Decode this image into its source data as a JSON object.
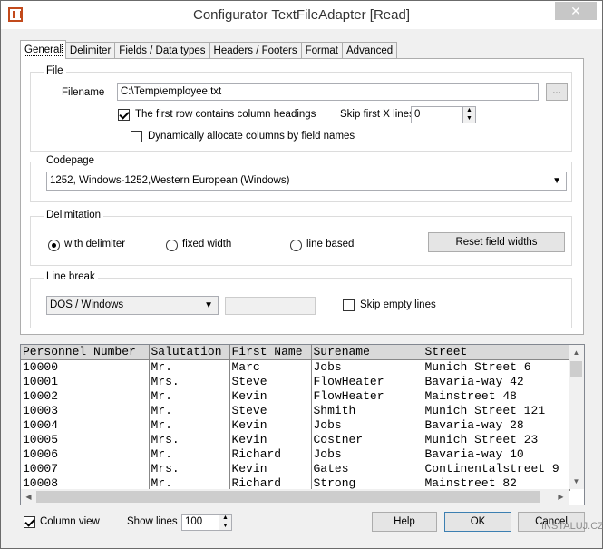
{
  "window": {
    "title": "Configurator TextFileAdapter  [Read]",
    "close_glyph": "✕"
  },
  "tabs": [
    {
      "label": "General"
    },
    {
      "label": "Delimiter"
    },
    {
      "label": "Fields / Data types"
    },
    {
      "label": "Headers / Footers"
    },
    {
      "label": "Format"
    },
    {
      "label": "Advanced"
    }
  ],
  "file": {
    "legend": "File",
    "filename_label": "Filename",
    "filename_value": "C:\\Temp\\employee.txt",
    "browse_label": "...",
    "first_row_label": "The first row contains column headings",
    "first_row_checked": true,
    "skip_label": "Skip first X lines",
    "skip_value": "0",
    "dynamic_label": "Dynamically allocate columns by field names",
    "dynamic_checked": false
  },
  "codepage": {
    "legend": "Codepage",
    "value": "1252, Windows-1252,Western European (Windows)"
  },
  "delimitation": {
    "legend": "Delimitation",
    "opt_delimiter": "with delimiter",
    "opt_fixed": "fixed width",
    "opt_line": "line based",
    "selected": "with delimiter",
    "reset_label": "Reset field widths"
  },
  "linebreak": {
    "legend": "Line break",
    "value": "DOS / Windows",
    "skip_empty_label": "Skip empty lines",
    "skip_empty_checked": false
  },
  "grid": {
    "columns": [
      "Personnel Number",
      "Salutation",
      "First Name",
      "Surename",
      "Street"
    ],
    "rows": [
      [
        "10000",
        "Mr.",
        "Marc",
        "Jobs",
        "Munich Street 6"
      ],
      [
        "10001",
        "Mrs.",
        "Steve",
        "FlowHeater",
        "Bavaria-way 42"
      ],
      [
        "10002",
        "Mr.",
        "Kevin",
        "FlowHeater",
        "Mainstreet 48"
      ],
      [
        "10003",
        "Mr.",
        "Steve",
        "Shmith",
        "Munich Street 121"
      ],
      [
        "10004",
        "Mr.",
        "Kevin",
        "Jobs",
        "Bavaria-way 28"
      ],
      [
        "10005",
        "Mrs.",
        "Kevin",
        "Costner",
        "Munich Street 23"
      ],
      [
        "10006",
        "Mr.",
        "Richard",
        "Jobs",
        "Bavaria-way 10"
      ],
      [
        "10007",
        "Mrs.",
        "Kevin",
        "Gates",
        "Continentalstreet 9"
      ],
      [
        "10008",
        "Mr.",
        "Richard",
        "Strong",
        "Mainstreet 82"
      ]
    ]
  },
  "footer": {
    "column_view_label": "Column view",
    "column_view_checked": true,
    "show_lines_label": "Show lines",
    "show_lines_value": "100",
    "help_label": "Help",
    "ok_label": "OK",
    "cancel_label": "Cancel"
  },
  "watermark": {
    "text": "INSTALUJ.CZ"
  }
}
